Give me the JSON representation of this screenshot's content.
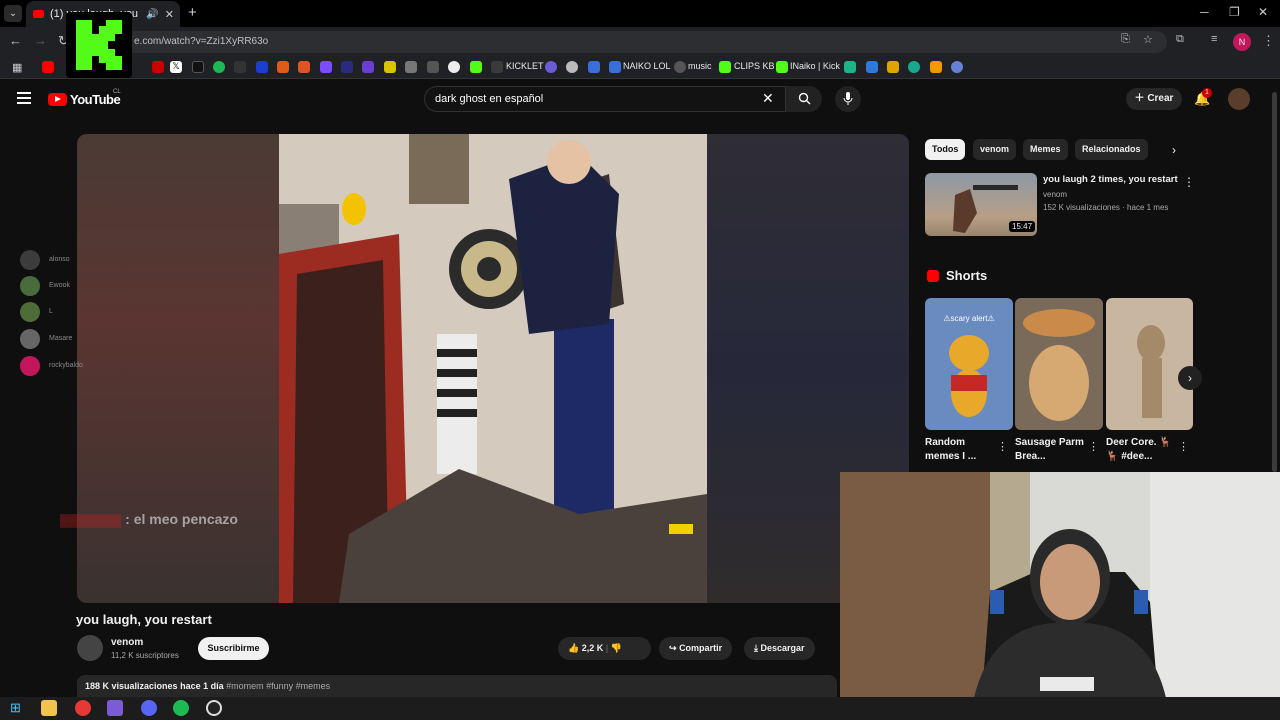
{
  "browser": {
    "tab_title": "(1) you laugh, you restart",
    "url": "e.com/watch?v=Zzi1XyRR63o",
    "bookmarks": [
      "KICKLET",
      "NAIKO LOL",
      "music",
      "CLIPS KB",
      "INaiko | Kick"
    ]
  },
  "youtube": {
    "logo": "YouTube",
    "country": "CL",
    "search_value": "dark ghost en español",
    "create_label": "Crear",
    "notif_count": "1"
  },
  "video": {
    "title": "you laugh, you restart",
    "channel": "venom",
    "subscribers": "11,2 K suscriptores",
    "subscribe_label": "Suscribirme",
    "likes": "2,2 K",
    "share_label": "Compartir",
    "download_label": "Descargar",
    "views": "188 K visualizaciones",
    "date": "hace 1 día",
    "tags": "#momem #funny #memes"
  },
  "chat": {
    "users": [
      "alonso",
      "Ewook",
      "L",
      "Masare",
      "rockybaldo"
    ],
    "message": ": el meo pencazo"
  },
  "chips": [
    "Todos",
    "venom",
    "Memes",
    "Relacionados"
  ],
  "recommended": {
    "title": "you laugh 2 times, you restart",
    "channel": "venom",
    "meta": "152 K visualizaciones · hace 1 mes",
    "duration": "15:47"
  },
  "shorts": {
    "heading": "Shorts",
    "items": [
      {
        "title": "Random memes I ...",
        "badge": "⚠scary alert⚠"
      },
      {
        "title": "Sausage Parm Brea..."
      },
      {
        "title": "Deer Core. 🦌 🦌 #dee..."
      }
    ]
  },
  "colors": {
    "accent": "#ff0000",
    "kick": "#53fc18"
  }
}
